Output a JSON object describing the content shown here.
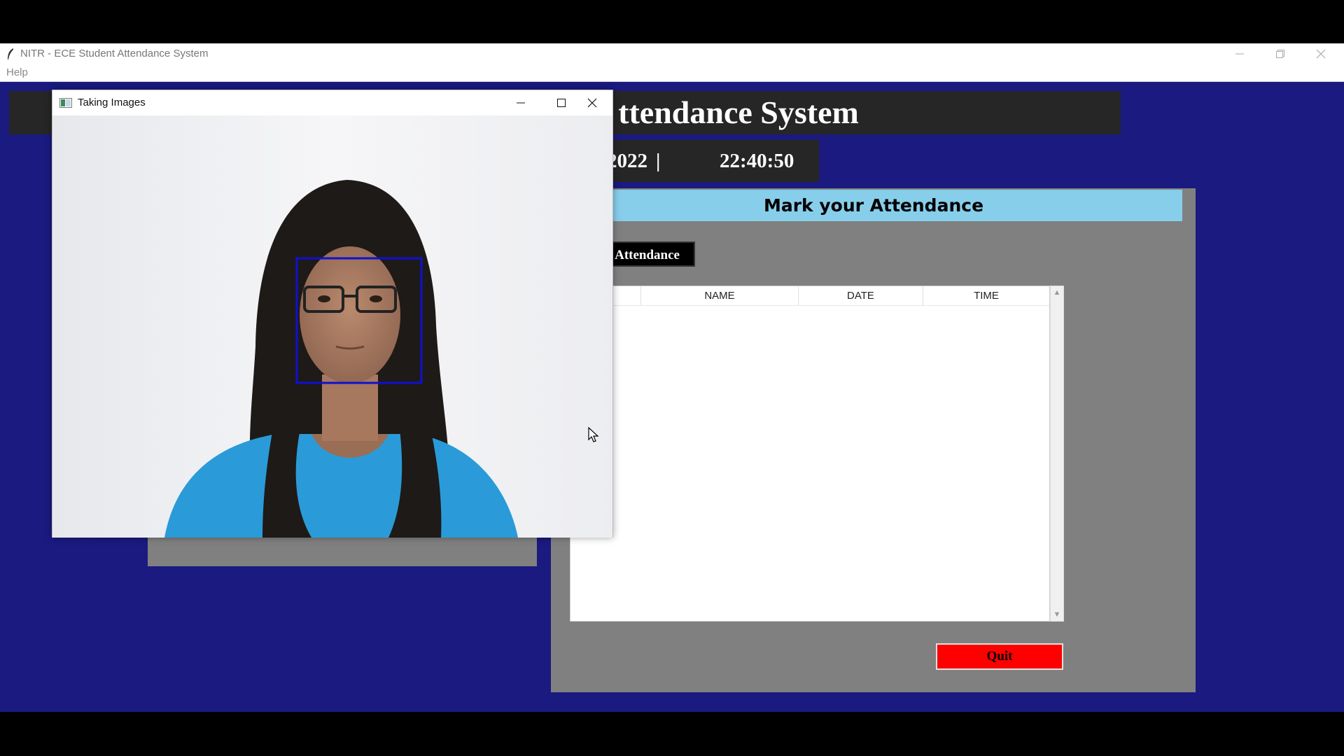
{
  "app": {
    "title": "NITR - ECE Student Attendance System",
    "menu": [
      "Help"
    ],
    "header_visible_text": "ttendance System",
    "date_visible_text": "2022",
    "separator": "|",
    "time": "22:40:50"
  },
  "attendance_panel": {
    "header": "Mark your Attendance",
    "take_button_visible_text": "Attendance",
    "columns": [
      "NAME",
      "DATE",
      "TIME"
    ],
    "rows": [],
    "quit_label": "Quit"
  },
  "camera_window": {
    "title": "Taking Images",
    "face_box_color": "#1010d0"
  },
  "colors": {
    "background": "#1a1a80",
    "panel": "#808080",
    "header_bg": "#262626",
    "panel_header": "#87ceeb",
    "quit": "#ff0000"
  }
}
